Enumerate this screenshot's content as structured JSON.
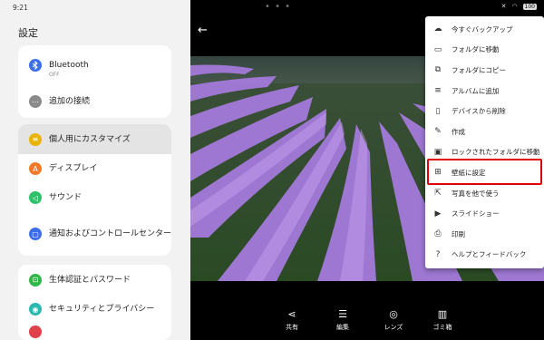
{
  "status": {
    "time": "9:21",
    "battery": "100"
  },
  "settings": {
    "title": "設定",
    "card1": [
      {
        "label": "Bluetooth",
        "sub": "OFF",
        "icon": "bluetooth-icon",
        "color": "#3b6ee8"
      },
      {
        "label": "追加の接続",
        "icon": "more-icon",
        "color": "#8a8a8a"
      }
    ],
    "card2": [
      {
        "label": "個人用にカスタマイズ",
        "icon": "palette-icon",
        "color": "#e8b400"
      },
      {
        "label": "ディスプレイ",
        "icon": "display-icon",
        "color": "#f07a2a"
      },
      {
        "label": "サウンド",
        "icon": "sound-icon",
        "color": "#2fc06a"
      },
      {
        "label": "通知およびコントロールセンター",
        "icon": "notification-icon",
        "color": "#3b6ee8"
      }
    ],
    "card3": [
      {
        "label": "生体認証とパスワード",
        "icon": "lock-icon",
        "color": "#2fb84a"
      },
      {
        "label": "セキュリティとプライバシー",
        "icon": "shield-icon",
        "color": "#2ab8b0"
      }
    ]
  },
  "menu": [
    {
      "label": "今すぐバックアップ",
      "icon": "cloud-upload-icon"
    },
    {
      "label": "フォルダに移動",
      "icon": "folder-move-icon"
    },
    {
      "label": "フォルダにコピー",
      "icon": "copy-icon"
    },
    {
      "label": "アルバムに追加",
      "icon": "playlist-add-icon"
    },
    {
      "label": "デバイスから削除",
      "icon": "phone-delete-icon"
    },
    {
      "label": "作成",
      "icon": "pencil-icon"
    },
    {
      "label": "ロックされたフォルダに移動",
      "icon": "folder-lock-icon"
    },
    {
      "label": "壁紙に設定",
      "icon": "wallpaper-icon"
    },
    {
      "label": "写真を他で使う",
      "icon": "open-external-icon"
    },
    {
      "label": "スライドショー",
      "icon": "slideshow-icon"
    },
    {
      "label": "印刷",
      "icon": "print-icon"
    },
    {
      "label": "ヘルプとフィードバック",
      "icon": "help-icon"
    }
  ],
  "toolbar": [
    {
      "label": "共有",
      "icon": "share-icon"
    },
    {
      "label": "編集",
      "icon": "tune-icon"
    },
    {
      "label": "レンズ",
      "icon": "lens-icon"
    },
    {
      "label": "ゴミ箱",
      "icon": "trash-icon"
    }
  ],
  "colors": {
    "highlight": "#e0000a",
    "lavender": "#a77be0"
  }
}
